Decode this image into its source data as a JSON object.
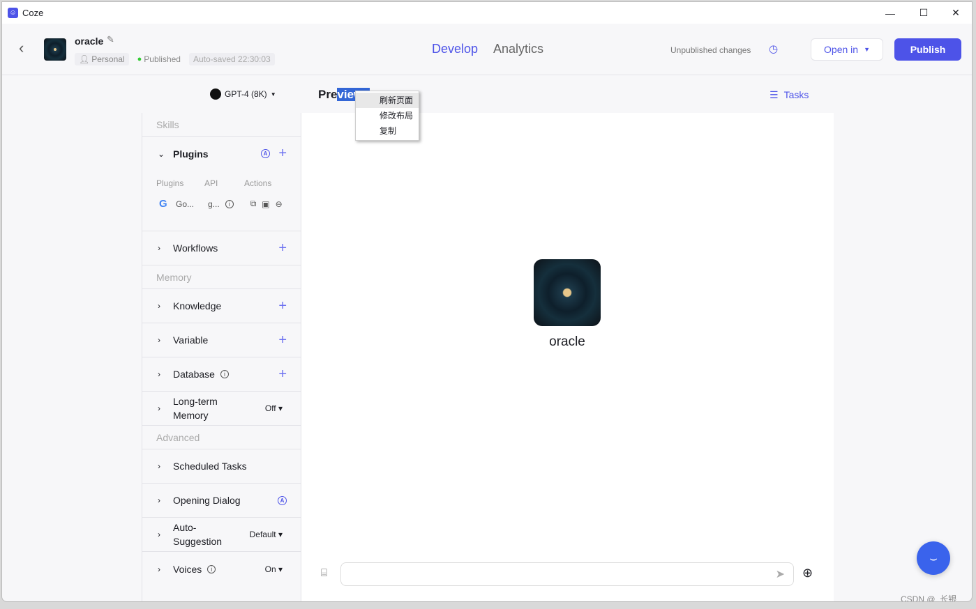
{
  "window": {
    "title": "Coze"
  },
  "header": {
    "bot_name": "oracle",
    "tags": {
      "personal": "Personal",
      "published": "Published",
      "autosaved": "Auto-saved 22:30:03"
    },
    "tabs": [
      {
        "label": "Develop",
        "active": true
      },
      {
        "label": "Analytics",
        "active": false
      }
    ],
    "unpublished": "Unpublished changes",
    "open_in": "Open in",
    "publish": "Publish"
  },
  "model": {
    "name": "GPT-4 (8K)"
  },
  "preview": {
    "title_plain": "Pre",
    "title_selected": "view",
    "tasks": "Tasks",
    "bot_name": "oracle"
  },
  "context_menu": [
    "刷新页面",
    "修改布局",
    "复制"
  ],
  "sidebar": {
    "skills": "Skills",
    "plugins": {
      "label": "Plugins",
      "cols": [
        "Plugins",
        "API",
        "Actions"
      ],
      "item_name": "Go...",
      "item_api": "g..."
    },
    "workflows": "Workflows",
    "memory": "Memory",
    "knowledge": "Knowledge",
    "variable": "Variable",
    "database": "Database",
    "ltm": {
      "label1": "Long-term",
      "label2": "Memory",
      "value": "Off"
    },
    "advanced": "Advanced",
    "scheduled": "Scheduled Tasks",
    "opening": "Opening Dialog",
    "autosugg": {
      "label1": "Auto-",
      "label2": "Suggestion",
      "value": "Default"
    },
    "voices": {
      "label": "Voices",
      "value": "On"
    }
  },
  "watermark": "CSDN @_长银_",
  "colors": {
    "accent": "#4d53e8",
    "fab": "#3a63ec"
  }
}
